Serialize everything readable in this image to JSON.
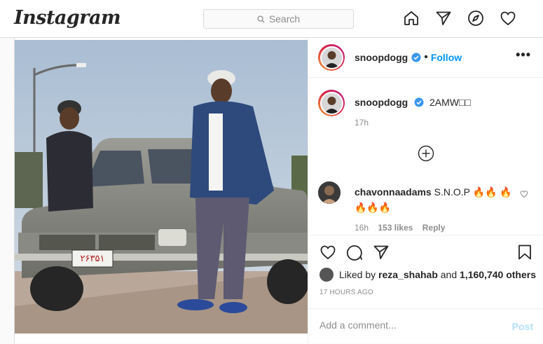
{
  "header": {
    "logo": "Instagram",
    "search_placeholder": "Search",
    "icons": [
      "home-icon",
      "direct-icon",
      "explore-icon",
      "activity-heart-icon"
    ]
  },
  "post": {
    "author": "snoopdogg",
    "follow_label": "Follow",
    "caption": "2AMW□□",
    "caption_time": "17h",
    "comment": {
      "author": "chavonnaadams",
      "text": "S.N.O.P 🔥🔥 🔥🔥🔥🔥",
      "time": "16h",
      "likes": "153 likes",
      "reply": "Reply"
    },
    "likes_prefix": "Liked by",
    "liked_by": "reza_shahab",
    "likes_and": "and",
    "likes_count": "1,160,740 others",
    "posted_ago": "17 HOURS AGO",
    "comment_placeholder": "Add a comment...",
    "post_label": "Post",
    "license_plate": "۲۶۳۵۱"
  },
  "colors": {
    "accent": "#0095f6",
    "post_disabled": "#b2dffc",
    "border": "#dbdbdb",
    "muted": "#8e8e8e"
  }
}
